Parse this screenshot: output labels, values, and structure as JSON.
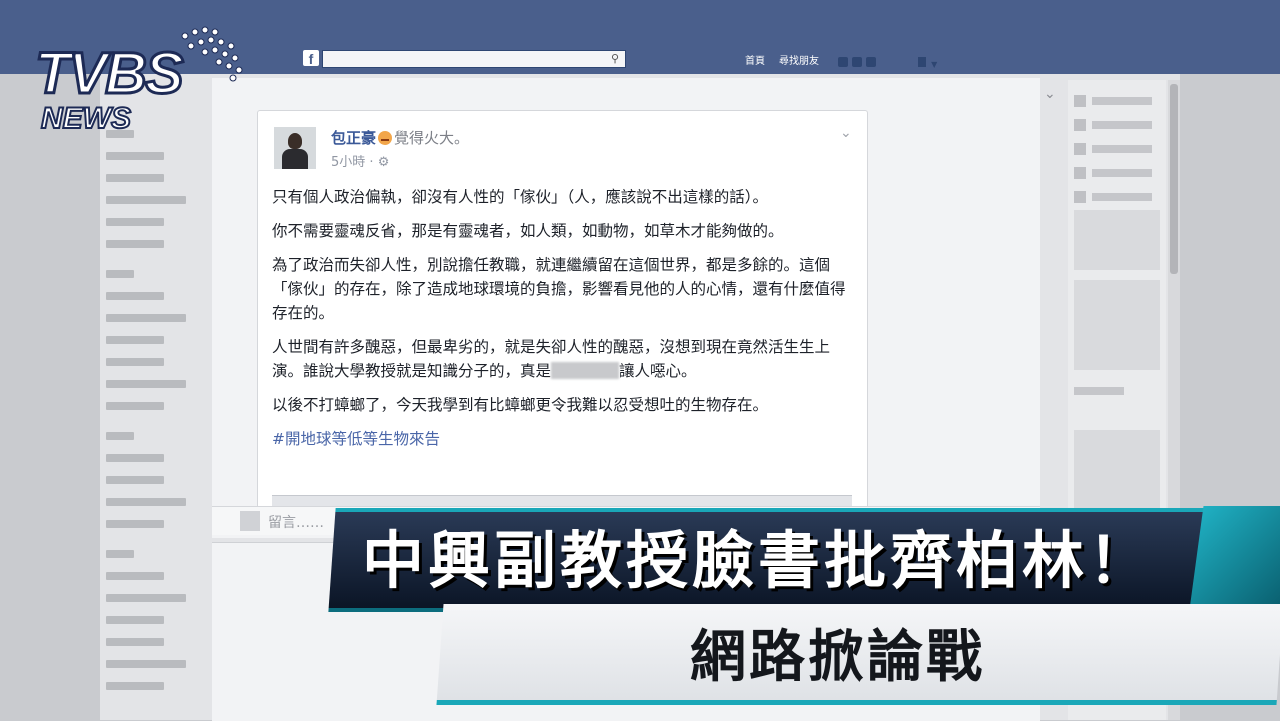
{
  "logo": {
    "brand": "TVBS",
    "sub": "NEWS"
  },
  "fb_bar": {
    "logo": "f",
    "search_icon": "search-icon",
    "nav": [
      "首頁",
      "尋找朋友"
    ]
  },
  "post": {
    "author": "包正豪",
    "feeling": "覺得火大。",
    "time": "5小時",
    "privacy_icon": "globe-icon",
    "paragraphs": [
      "只有個人政治偏執，卻沒有人性的「傢伙」（人，應該說不出這樣的話）。",
      "你不需要靈魂反省，那是有靈魂者，如人類，如動物，如草木才能夠做的。",
      "為了政治而失卻人性，別說擔任教職，就連繼續留在這個世界，都是多餘的。這個「傢伙」的存在，除了造成地球環境的負擔，影響看見他的人的心情，還有什麼值得存在的。",
      "以後不打蟑螂了，今天我學到有比蟑螂更令我難以忍受想吐的生物存在。"
    ],
    "p4_before": "人世間有許多醜惡，但最卑劣的，就是失卻人性的醜惡，沒想到現在竟然活生生上演。誰說大學教授就是知識分子的，真是",
    "p4_after": "讓人噁心。",
    "hashtag": "#開地球等低等生物來告"
  },
  "comment_placeholder": "留言……",
  "caption": {
    "headline": "中興副教授臉書批齊柏林！",
    "subline": "網路掀論戰"
  }
}
